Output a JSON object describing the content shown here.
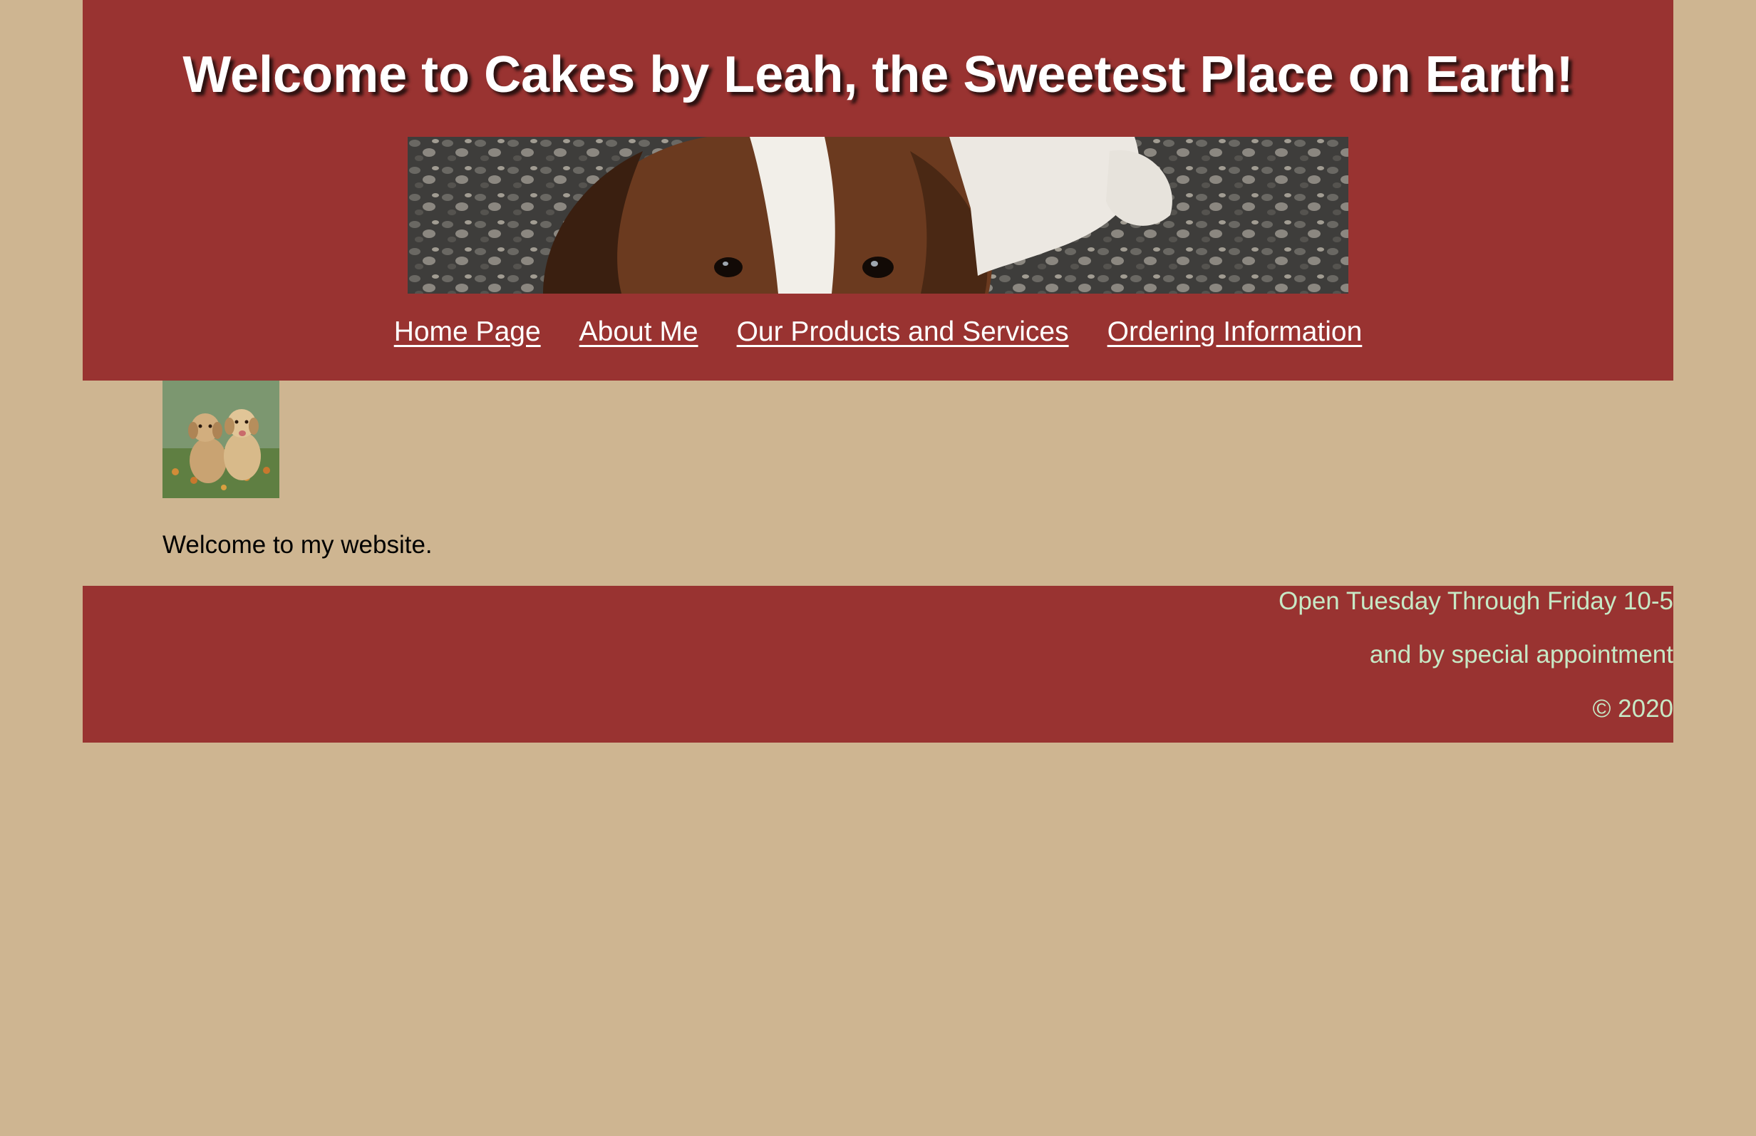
{
  "page": {
    "background_color": "#CEB591",
    "accent_color": "#993331",
    "footer_text_color": "#C7E8C5"
  },
  "header": {
    "title": "Welcome to Cakes by Leah, the Sweetest Place on Earth!",
    "banner_image": "beagle-puppy-banner"
  },
  "nav": {
    "items": [
      {
        "label": "Home Page"
      },
      {
        "label": "About Me"
      },
      {
        "label": "Our Products and Services"
      },
      {
        "label": "Ordering Information"
      }
    ]
  },
  "main": {
    "thumbnail_image": "golden-retriever-puppies",
    "welcome_text": "Welcome to my website."
  },
  "footer": {
    "hours": "Open Tuesday Through Friday 10-5",
    "appointment": "and by special appointment",
    "copyright": "© 2020"
  }
}
